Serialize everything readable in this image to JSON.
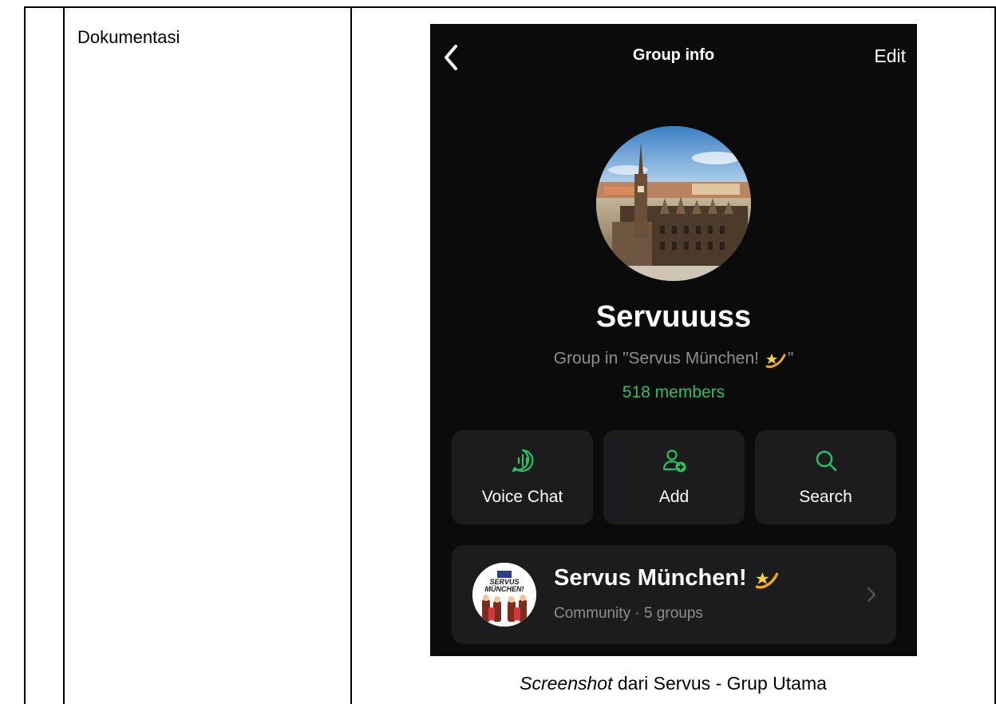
{
  "document": {
    "label_cell": "Dokumentasi",
    "caption_italic": "Screenshot",
    "caption_rest": " dari Servus - Grup Utama"
  },
  "phone": {
    "header": {
      "title": "Group info",
      "edit": "Edit",
      "back_icon": "chevron-left-icon"
    },
    "group": {
      "name": "Servuuuss",
      "subtitle": "Group in \"Servus München! ",
      "subtitle_end": "\"",
      "members": "518 members",
      "avatar": "munich-city-hall-photo"
    },
    "actions": [
      {
        "label": "Voice Chat",
        "icon": "voice-chat-icon"
      },
      {
        "label": "Add",
        "icon": "add-person-icon"
      },
      {
        "label": "Search",
        "icon": "search-icon"
      }
    ],
    "community": {
      "title": "Servus München! ",
      "subtitle": "Community · 5 groups",
      "logo_text_1": "SERVUS",
      "logo_text_2": "MÜNCHEN!"
    },
    "colors": {
      "background": "#0b0b0b",
      "card": "#1c1c1e",
      "accent_green": "#25c266",
      "secondary_text": "#8e8e93"
    }
  }
}
